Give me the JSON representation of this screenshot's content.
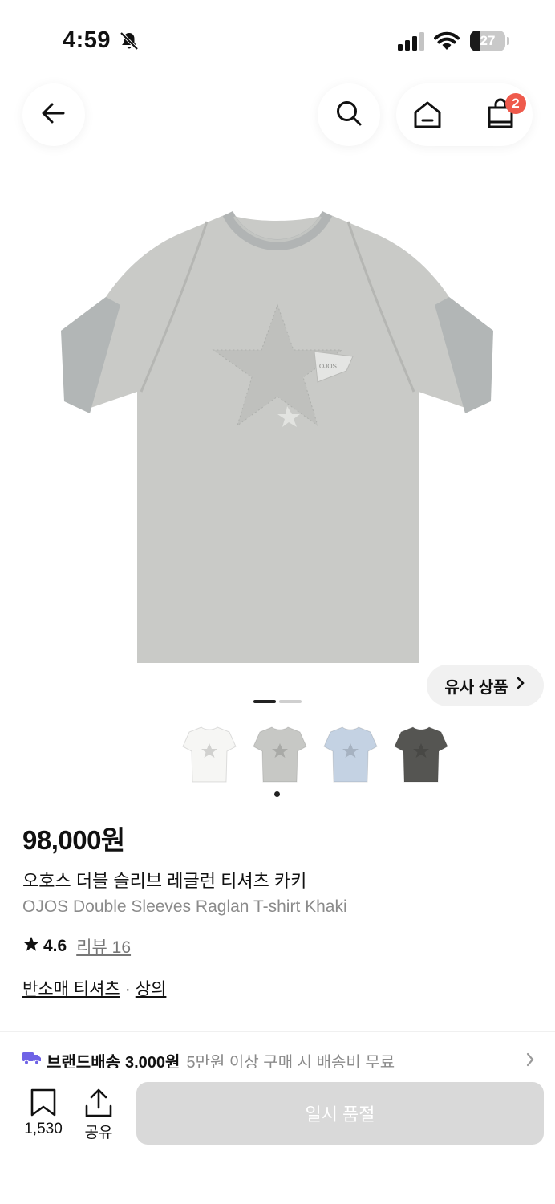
{
  "status": {
    "time": "4:59",
    "battery": "27",
    "battery_level": 0.27
  },
  "nav": {
    "cart_count": "2"
  },
  "hero": {
    "badge_text": "OJOS",
    "pager_count": 2,
    "active_page": 1
  },
  "similar_products": {
    "label": "유사 상품"
  },
  "thumbnails": {
    "items": [
      {
        "color_name": "white",
        "color": "#f6f6f4"
      },
      {
        "color_name": "khaki",
        "color": "#c7c8c5"
      },
      {
        "color_name": "sky blue",
        "color": "#c4d2e3"
      },
      {
        "color_name": "charcoal",
        "color": "#555552"
      }
    ]
  },
  "product": {
    "price": "98,000원",
    "name_ko": "오호스 더블 슬리브 레글런 티셔츠 카키",
    "name_en": "OJOS Double Sleeves Raglan T-shirt Khaki",
    "rating": "4.6",
    "review_label": "리뷰 16",
    "category_sub": "반소매 티셔츠",
    "category_separator": "·",
    "category_main": "상의"
  },
  "delivery": {
    "type": "브랜드배송",
    "fee": "3,000원",
    "condition": "5만원 이상 구매 시 배송비 무료"
  },
  "bottom": {
    "bookmark_count": "1,530",
    "share_label": "공유",
    "soldout_label": "일시 품절"
  },
  "colors": {
    "accent_red": "#ef5a4c",
    "delivery_purple": "#6f63e6",
    "disabled_gray": "#d9d9d9"
  }
}
